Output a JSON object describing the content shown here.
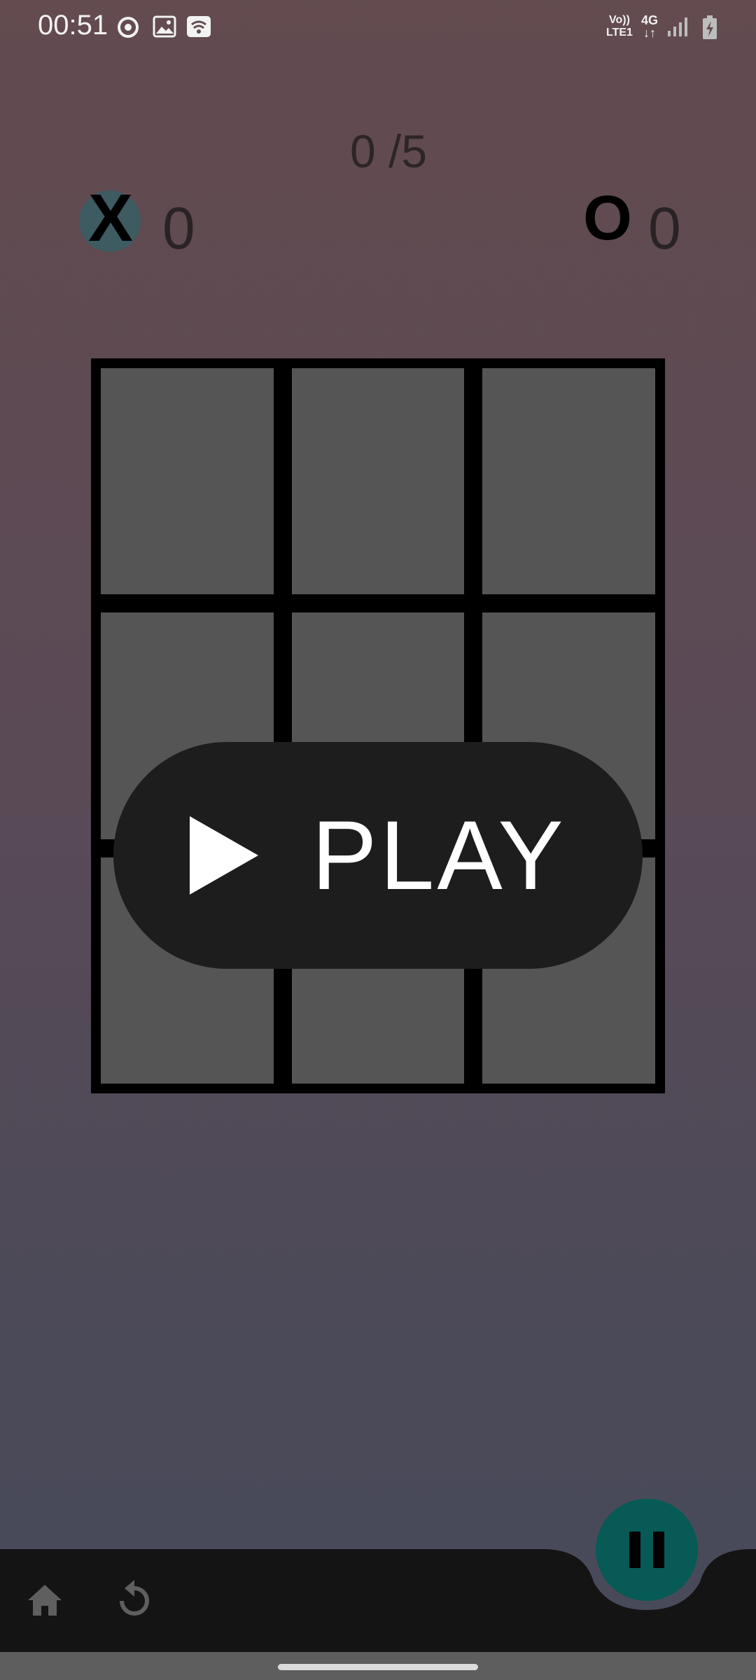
{
  "status_bar": {
    "time": "00:51",
    "network_volte": "Vo))\nLTE1",
    "network_type": "4G",
    "icons": [
      "sync-icon",
      "image-icon",
      "wifi-icon",
      "signal-icon",
      "battery-charging-icon"
    ]
  },
  "game": {
    "round": "0 /5",
    "player_x": {
      "symbol": "X",
      "score": "0"
    },
    "player_o": {
      "symbol": "O",
      "score": "0"
    },
    "board_cells": [
      "",
      "",
      "",
      "",
      "",
      "",
      "",
      "",
      ""
    ]
  },
  "overlay": {
    "play_label": "PLAY"
  },
  "bottom_bar": {
    "icons": [
      "home-icon",
      "refresh-icon",
      "pause-icon"
    ]
  },
  "colors": {
    "x_badge": "#3d5b60",
    "cell": "#555555",
    "fab": "#075a55",
    "bottom_bar": "#141414"
  }
}
